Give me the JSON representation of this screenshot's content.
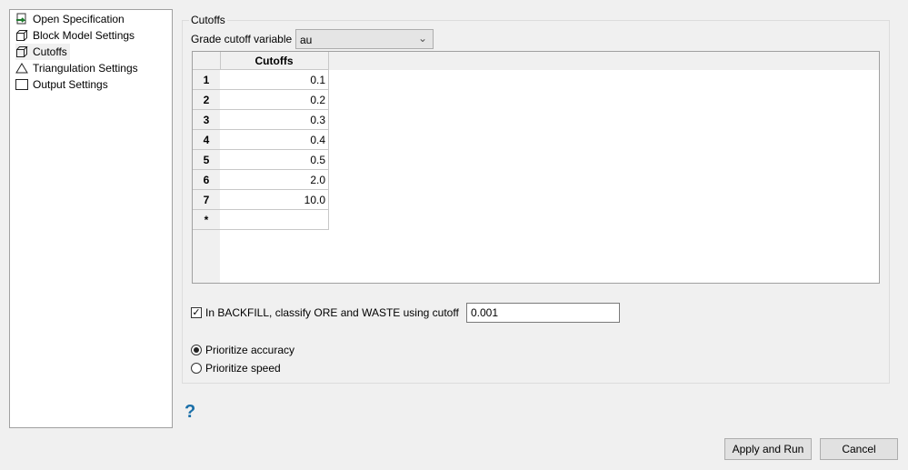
{
  "sidebar": {
    "items": [
      {
        "label": "Open Specification",
        "icon": "open-spec-icon"
      },
      {
        "label": "Block Model Settings",
        "icon": "cube-icon"
      },
      {
        "label": "Cutoffs",
        "icon": "cube-icon",
        "selected": true
      },
      {
        "label": "Triangulation Settings",
        "icon": "triangle-icon"
      },
      {
        "label": "Output Settings",
        "icon": "square-icon"
      }
    ]
  },
  "group": {
    "title": "Cutoffs",
    "grade_label": "Grade cutoff variable",
    "grade_value": "au",
    "table": {
      "column": "Cutoffs",
      "rows": [
        {
          "h": "1",
          "v": "0.1"
        },
        {
          "h": "2",
          "v": "0.2"
        },
        {
          "h": "3",
          "v": "0.3"
        },
        {
          "h": "4",
          "v": "0.4"
        },
        {
          "h": "5",
          "v": "0.5"
        },
        {
          "h": "6",
          "v": "2.0"
        },
        {
          "h": "7",
          "v": "10.0"
        },
        {
          "h": "*",
          "v": ""
        }
      ]
    },
    "backfill_label": "In BACKFILL, classify ORE and WASTE using cutoff",
    "backfill_checked": true,
    "backfill_value": "0.001",
    "radio_accuracy": "Prioritize accuracy",
    "radio_speed": "Prioritize speed"
  },
  "help": "?",
  "buttons": {
    "apply": "Apply and Run",
    "cancel": "Cancel"
  }
}
